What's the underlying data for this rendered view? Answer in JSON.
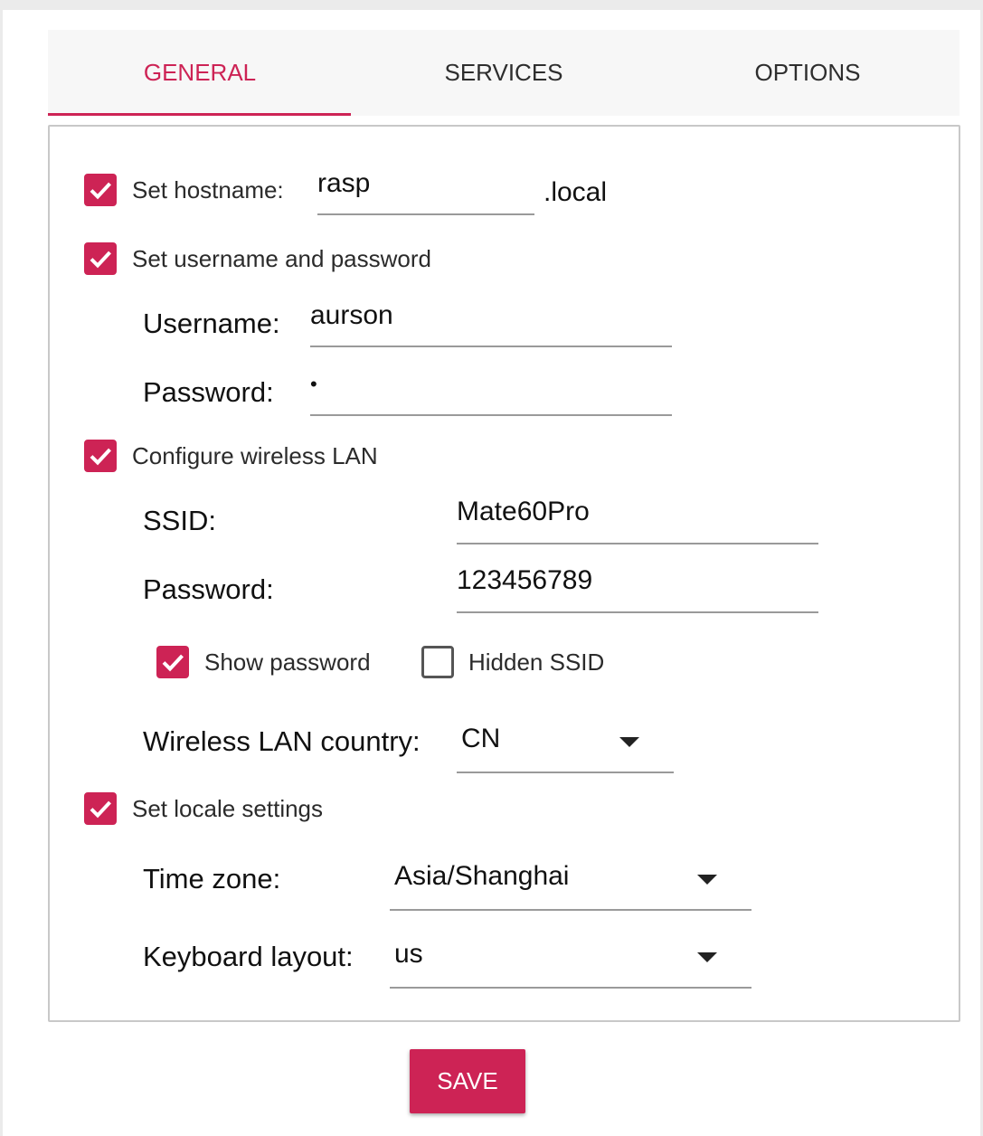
{
  "colors": {
    "accent": "#cd2355",
    "text": "#2b2b2b",
    "border": "#c8c8c8"
  },
  "tabs": [
    {
      "label": "GENERAL",
      "active": true
    },
    {
      "label": "SERVICES",
      "active": false
    },
    {
      "label": "OPTIONS",
      "active": false
    }
  ],
  "hostname": {
    "checked": true,
    "label": "Set hostname:",
    "value": "rasp",
    "suffix": ".local"
  },
  "credentials": {
    "checked": true,
    "label": "Set username and password",
    "username_label": "Username:",
    "username_value": "aurson",
    "password_label": "Password:",
    "password_value": "•"
  },
  "wireless": {
    "checked": true,
    "label": "Configure wireless LAN",
    "ssid_label": "SSID:",
    "ssid_value": "Mate60Pro",
    "password_label": "Password:",
    "password_value": "123456789",
    "show_password": {
      "label": "Show password",
      "checked": true
    },
    "hidden_ssid": {
      "label": "Hidden SSID",
      "checked": false
    },
    "country_label": "Wireless LAN country:",
    "country_value": "CN"
  },
  "locale": {
    "checked": true,
    "label": "Set locale settings",
    "timezone_label": "Time zone:",
    "timezone_value": "Asia/Shanghai",
    "keyboard_label": "Keyboard layout:",
    "keyboard_value": "us"
  },
  "save_label": "SAVE",
  "icons": {
    "checkbox_checked": "checkmark-icon",
    "dropdown": "triangle-down-icon"
  }
}
